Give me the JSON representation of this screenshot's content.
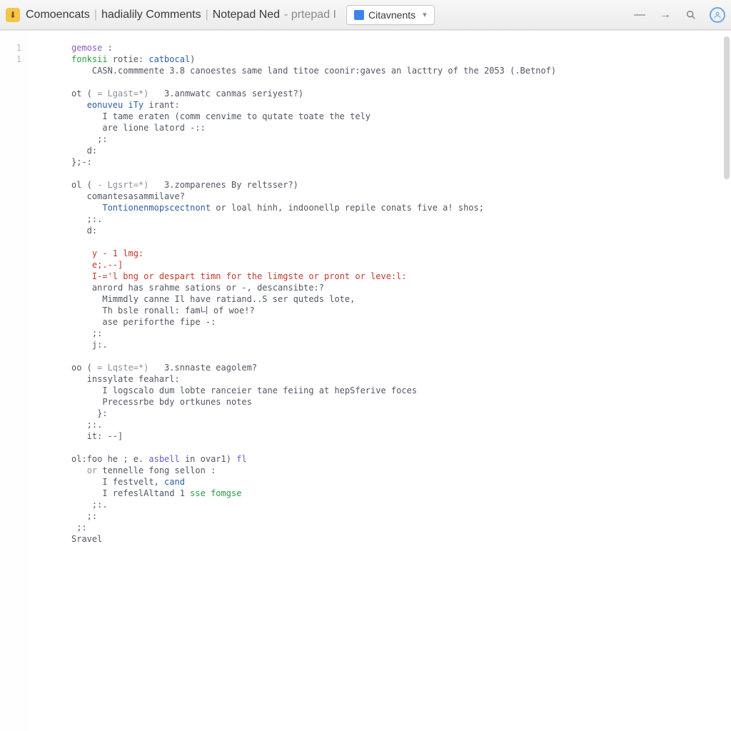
{
  "titlebar": {
    "crumb1": "Comoencats",
    "crumb2": "hadialily Comments",
    "crumb3": "Notepad Ned",
    "crumb4": "prtepad I",
    "dropdown_label": "Citavnents"
  },
  "gutter": {
    "l1": "1",
    "l2": "1"
  },
  "code": {
    "lines": [
      {
        "frags": [
          {
            "cls": "tok-keyword",
            "t": "gemose"
          },
          {
            "cls": "",
            "t": " :"
          }
        ]
      },
      {
        "frags": [
          {
            "cls": "tok-func",
            "t": "fonksii"
          },
          {
            "cls": "",
            "t": " rotie: "
          },
          {
            "cls": "tok-blue",
            "t": "catbocal"
          },
          {
            "cls": "",
            "t": ")"
          }
        ]
      },
      {
        "frags": [
          {
            "cls": "",
            "t": "    CASN.commmente 3.8 canoestes same land titoe coonir:gaves an lacttry of the 2053 (.Betnof)"
          }
        ]
      },
      {
        "frags": [
          {
            "cls": "",
            "t": ""
          }
        ]
      },
      {
        "frags": [
          {
            "cls": "",
            "t": "ot ( "
          },
          {
            "cls": "tok-gray",
            "t": "= Lgast=*)"
          },
          {
            "cls": "",
            "t": "   3.anmwatc canmas seriyest?)"
          }
        ]
      },
      {
        "frags": [
          {
            "cls": "",
            "t": "   "
          },
          {
            "cls": "tok-blue",
            "t": "eonuveu iTy"
          },
          {
            "cls": "",
            "t": " irant:"
          }
        ]
      },
      {
        "frags": [
          {
            "cls": "",
            "t": "      I tame eraten (comm cenvime to qutate toate the tely"
          }
        ]
      },
      {
        "frags": [
          {
            "cls": "",
            "t": "      are lione latord -::"
          }
        ]
      },
      {
        "frags": [
          {
            "cls": "",
            "t": "     ;:"
          }
        ]
      },
      {
        "frags": [
          {
            "cls": "",
            "t": "   d:"
          }
        ]
      },
      {
        "frags": [
          {
            "cls": "",
            "t": "};-:"
          }
        ]
      },
      {
        "frags": [
          {
            "cls": "",
            "t": ""
          }
        ]
      },
      {
        "frags": [
          {
            "cls": "",
            "t": "ol ( "
          },
          {
            "cls": "tok-gray",
            "t": "- Lgsrt=*)"
          },
          {
            "cls": "",
            "t": "   3.zomparenes By reltsser?)"
          }
        ]
      },
      {
        "frags": [
          {
            "cls": "",
            "t": "   comantesasammilave?"
          }
        ]
      },
      {
        "frags": [
          {
            "cls": "",
            "t": "      "
          },
          {
            "cls": "tok-blue",
            "t": "Tontionenmopscectnont"
          },
          {
            "cls": "",
            "t": " or loal hinh, indoonellp repile conats five a! shos;"
          }
        ]
      },
      {
        "frags": [
          {
            "cls": "",
            "t": "   ;:."
          }
        ]
      },
      {
        "frags": [
          {
            "cls": "",
            "t": "   d:"
          }
        ]
      },
      {
        "frags": [
          {
            "cls": "",
            "t": ""
          }
        ]
      },
      {
        "frags": [
          {
            "cls": "",
            "t": "    "
          },
          {
            "cls": "tok-red",
            "t": "y - 1 lmg:"
          }
        ]
      },
      {
        "frags": [
          {
            "cls": "",
            "t": "    "
          },
          {
            "cls": "tok-red",
            "t": "e;.--]"
          }
        ]
      },
      {
        "frags": [
          {
            "cls": "",
            "t": "    "
          },
          {
            "cls": "tok-red",
            "t": "I-='l bng or despart timn for the limgste or pront or leve:l:"
          }
        ]
      },
      {
        "frags": [
          {
            "cls": "",
            "t": "    anrord has srahme sations or -, descansibte:?"
          }
        ]
      },
      {
        "frags": [
          {
            "cls": "",
            "t": "      Mimmdly canne Il have ratiand..S ser quteds lote,"
          }
        ]
      },
      {
        "frags": [
          {
            "cls": "",
            "t": "      Th bsle ronall: fam니 of woe!?"
          }
        ]
      },
      {
        "frags": [
          {
            "cls": "",
            "t": "      ase periforthe fipe -:"
          }
        ]
      },
      {
        "frags": [
          {
            "cls": "",
            "t": "    ;:"
          }
        ]
      },
      {
        "frags": [
          {
            "cls": "",
            "t": "    j:."
          }
        ]
      },
      {
        "frags": [
          {
            "cls": "",
            "t": ""
          }
        ]
      },
      {
        "frags": [
          {
            "cls": "",
            "t": "oo ( "
          },
          {
            "cls": "tok-gray",
            "t": "= Lqste=*)"
          },
          {
            "cls": "",
            "t": "   3.snnaste eagolem?"
          }
        ]
      },
      {
        "frags": [
          {
            "cls": "",
            "t": "   inssylate feaharl:"
          }
        ]
      },
      {
        "frags": [
          {
            "cls": "",
            "t": "      I logscalo dum lobte ranceier tane feiing at hepSferive foces"
          }
        ]
      },
      {
        "frags": [
          {
            "cls": "",
            "t": "      Precessrbe bdy ortkunes notes"
          }
        ]
      },
      {
        "frags": [
          {
            "cls": "",
            "t": "     }:"
          }
        ]
      },
      {
        "frags": [
          {
            "cls": "",
            "t": "   ;:."
          }
        ]
      },
      {
        "frags": [
          {
            "cls": "",
            "t": "   it: --]"
          }
        ]
      },
      {
        "frags": [
          {
            "cls": "",
            "t": ""
          }
        ]
      },
      {
        "frags": [
          {
            "cls": "",
            "t": "ol:foo he ; e. "
          },
          {
            "cls": "tok-purple",
            "t": "asbell"
          },
          {
            "cls": "",
            "t": " in ovar1) "
          },
          {
            "cls": "tok-purple",
            "t": "fl"
          }
        ]
      },
      {
        "frags": [
          {
            "cls": "",
            "t": "   "
          },
          {
            "cls": "tok-gray",
            "t": "or"
          },
          {
            "cls": "",
            "t": " tennelle fong sellon :"
          }
        ]
      },
      {
        "frags": [
          {
            "cls": "",
            "t": "      I festvelt, "
          },
          {
            "cls": "tok-blue",
            "t": "cand"
          }
        ]
      },
      {
        "frags": [
          {
            "cls": "",
            "t": "      I refeslAltand 1 "
          },
          {
            "cls": "tok-func",
            "t": "sse fomgse"
          }
        ]
      },
      {
        "frags": [
          {
            "cls": "",
            "t": "    ;:."
          }
        ]
      },
      {
        "frags": [
          {
            "cls": "",
            "t": "   ;:"
          }
        ]
      },
      {
        "frags": [
          {
            "cls": "",
            "t": " ;:"
          }
        ]
      },
      {
        "frags": [
          {
            "cls": "",
            "t": "Sravel"
          }
        ]
      }
    ]
  }
}
